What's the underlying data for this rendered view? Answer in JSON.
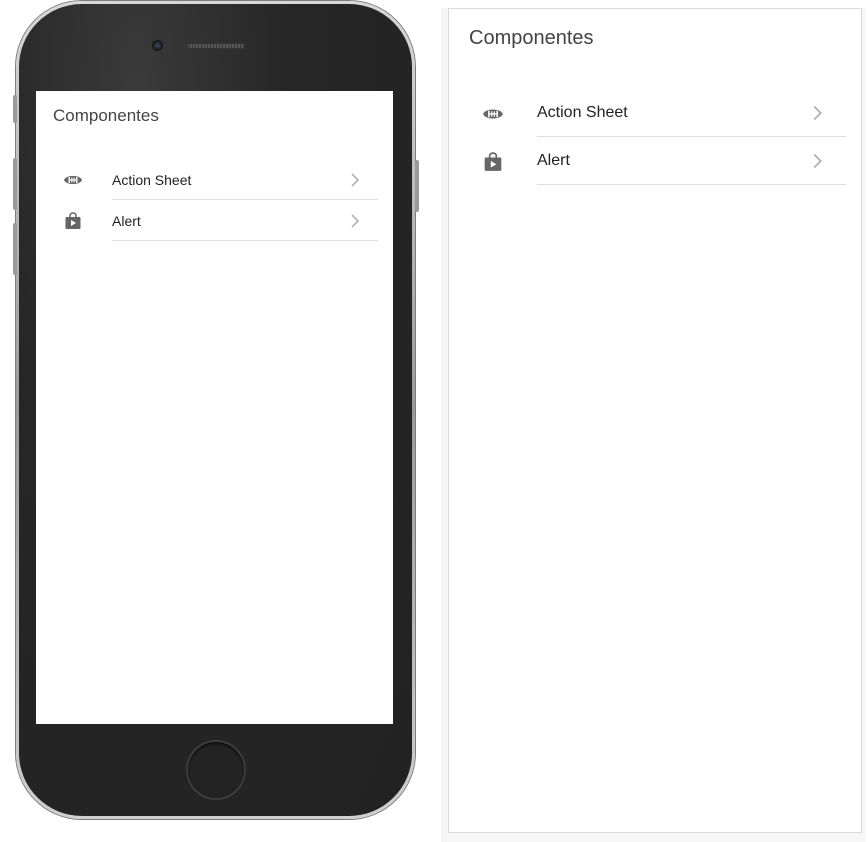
{
  "app": {
    "title": "Componentes"
  },
  "list": {
    "items": [
      {
        "label": "Action Sheet",
        "icon": "football-icon"
      },
      {
        "label": "Alert",
        "icon": "play-store-bag-icon"
      }
    ],
    "chevron_icon": "chevron-right-icon"
  },
  "colors": {
    "icon": "#666666",
    "chevron": "#aaaaaa",
    "divider": "#dddddd",
    "title": "#444444",
    "phone_body": "#262626"
  }
}
